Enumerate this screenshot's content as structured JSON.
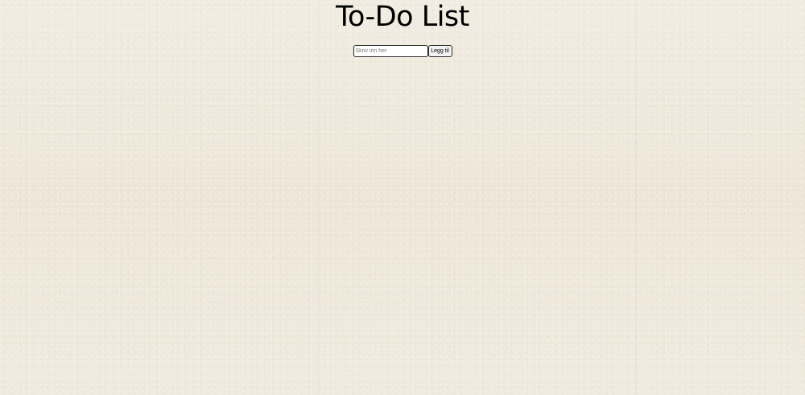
{
  "header": {
    "title": "To-Do List"
  },
  "add_form": {
    "input_placeholder": "Skriv inn her",
    "input_value": "",
    "add_button_label": "Legg til"
  },
  "todos": [],
  "colors": {
    "background": "#efe9dd",
    "title_text": "#000000",
    "input_border": "#2b2b2b"
  }
}
